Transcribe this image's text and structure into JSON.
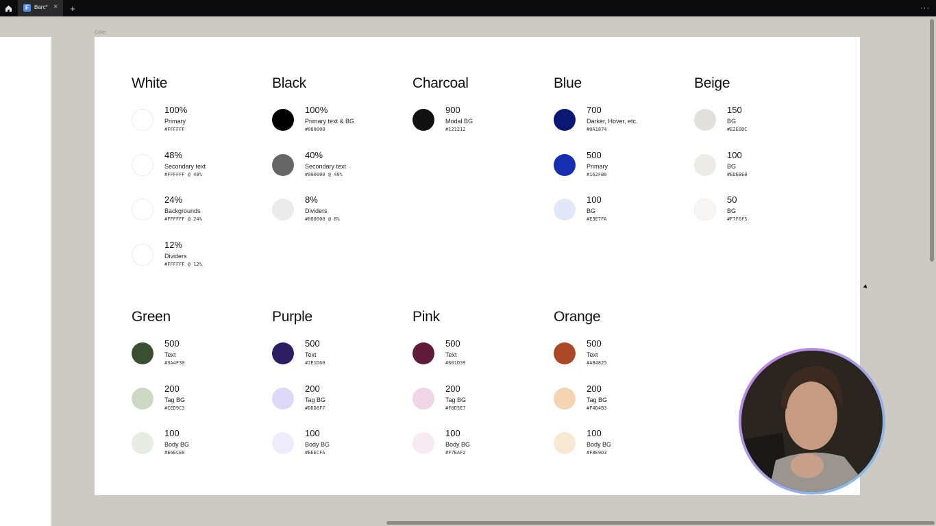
{
  "tabbar": {
    "tab_title": "Barc*",
    "close_glyph": "×",
    "new_tab_glyph": "+",
    "more_glyph": "···"
  },
  "canvas": {
    "frame_label": "Color"
  },
  "color_groups": [
    {
      "name": "White",
      "swatches": [
        {
          "value": "100%",
          "role": "Primary",
          "hex": "#FFFFFF",
          "color": "#FFFFFF"
        },
        {
          "value": "48%",
          "role": "Secondary text",
          "hex": "#FFFFFF @ 48%",
          "color": "#FFFFFF"
        },
        {
          "value": "24%",
          "role": "Backgrounds",
          "hex": "#FFFFFF @ 24%",
          "color": "#FFFFFF"
        },
        {
          "value": "12%",
          "role": "Dividers",
          "hex": "#FFFFFF @ 12%",
          "color": "#FFFFFF"
        }
      ]
    },
    {
      "name": "Black",
      "swatches": [
        {
          "value": "100%",
          "role": "Primary text & BG",
          "hex": "#000000",
          "color": "#000000"
        },
        {
          "value": "40%",
          "role": "Secondary text",
          "hex": "#000000 @ 40%",
          "color": "#666666"
        },
        {
          "value": "8%",
          "role": "Dividers",
          "hex": "#000000 @ 8%",
          "color": "#EBEBEB"
        }
      ]
    },
    {
      "name": "Charcoal",
      "swatches": [
        {
          "value": "900",
          "role": "Modal BG",
          "hex": "#121212",
          "color": "#121212"
        }
      ]
    },
    {
      "name": "Blue",
      "swatches": [
        {
          "value": "700",
          "role": "Darker, Hover, etc.",
          "hex": "#0A1874",
          "color": "#0A1874"
        },
        {
          "value": "500",
          "role": "Primary",
          "hex": "#162FB0",
          "color": "#162FB0"
        },
        {
          "value": "100",
          "role": "BG",
          "hex": "#E3E7FA",
          "color": "#E3E7FA"
        }
      ]
    },
    {
      "name": "Beige",
      "swatches": [
        {
          "value": "150",
          "role": "BG",
          "hex": "#E2E0DC",
          "color": "#E2E0DC"
        },
        {
          "value": "100",
          "role": "BG",
          "hex": "#EDEBE8",
          "color": "#EDEBE8"
        },
        {
          "value": "50",
          "role": "BG",
          "hex": "#F7F6F5",
          "color": "#F7F6F5"
        }
      ]
    },
    {
      "name": "Green",
      "swatches": [
        {
          "value": "500",
          "role": "Text",
          "hex": "#3A4F30",
          "color": "#3A4F30"
        },
        {
          "value": "200",
          "role": "Tag BG",
          "hex": "#CED9C3",
          "color": "#CED9C3"
        },
        {
          "value": "100",
          "role": "Body BG",
          "hex": "#E6ECE0",
          "color": "#E6ECE0"
        }
      ]
    },
    {
      "name": "Purple",
      "swatches": [
        {
          "value": "500",
          "role": "Text",
          "hex": "#2E1D60",
          "color": "#2E1D60"
        },
        {
          "value": "200",
          "role": "Tag BG",
          "hex": "#DDD8F7",
          "color": "#DDD8F7"
        },
        {
          "value": "100",
          "role": "Body BG",
          "hex": "#EEECFA",
          "color": "#EEECFA"
        }
      ]
    },
    {
      "name": "Pink",
      "swatches": [
        {
          "value": "500",
          "role": "Text",
          "hex": "#601D39",
          "color": "#601D39"
        },
        {
          "value": "200",
          "role": "Tag BG",
          "hex": "#F0D5E7",
          "color": "#F0D5E7"
        },
        {
          "value": "100",
          "role": "Body BG",
          "hex": "#F7EAF2",
          "color": "#F7EAF2"
        }
      ]
    },
    {
      "name": "Orange",
      "swatches": [
        {
          "value": "500",
          "role": "Text",
          "hex": "#AB4825",
          "color": "#AB4825"
        },
        {
          "value": "200",
          "role": "Tag BG",
          "hex": "#F4D4B3",
          "color": "#F4D4B3"
        },
        {
          "value": "100",
          "role": "Body BG",
          "hex": "#F8E9D3",
          "color": "#F8E9D3"
        }
      ]
    }
  ]
}
